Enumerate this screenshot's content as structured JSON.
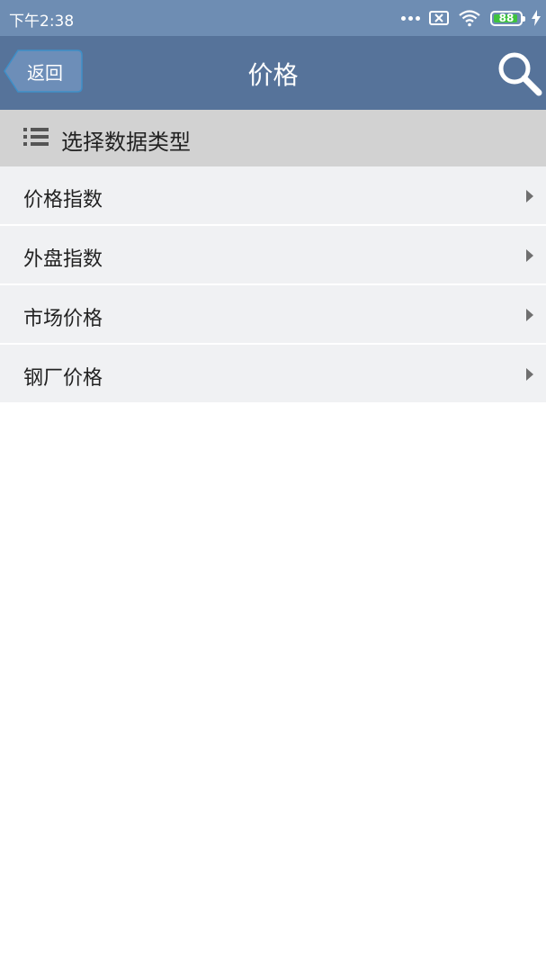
{
  "status_bar": {
    "time": "下午2:38",
    "battery_level": "88",
    "icons": [
      "more-dots-icon",
      "sim-x-icon",
      "wifi-icon",
      "battery-icon",
      "charging-icon"
    ]
  },
  "nav": {
    "back_label": "返回",
    "title": "价格",
    "search_icon": "search-icon"
  },
  "section": {
    "title": "选择数据类型",
    "icon": "list-icon"
  },
  "menu": {
    "items": [
      {
        "label": "价格指数"
      },
      {
        "label": "外盘指数"
      },
      {
        "label": "市场价格"
      },
      {
        "label": "钢厂价格"
      }
    ]
  },
  "colors": {
    "status_bar": "#6e8db3",
    "nav_bar": "#56739a",
    "section_header": "#d2d2d2",
    "list_item": "#f0f1f3",
    "battery": "#3ec33e"
  }
}
